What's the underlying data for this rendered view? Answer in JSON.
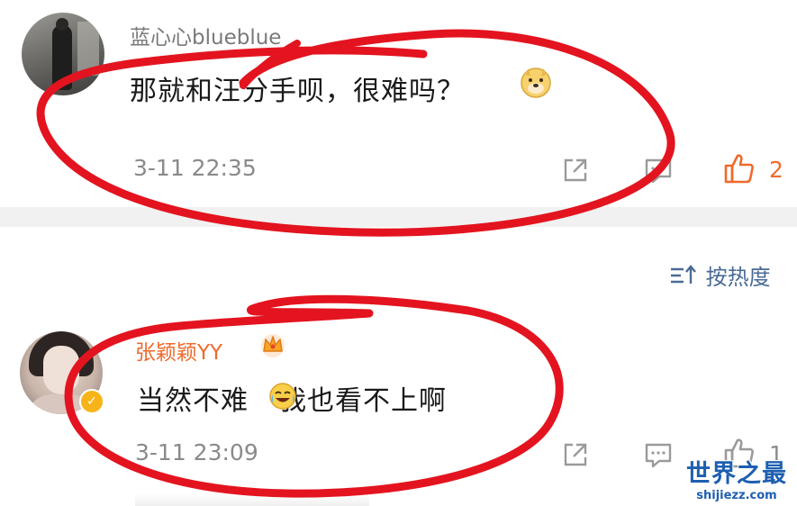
{
  "colors": {
    "accent_orange": "#ef6a2c",
    "link_blue": "#4a6b96",
    "annotation_red": "#e3141f",
    "meta_gray": "#8a8a8a"
  },
  "comments": [
    {
      "username": "蓝心心blueblue",
      "text": "那就和汪分手呗，很难吗？",
      "emoji": "doge-emoji",
      "timestamp": "3-11 22:35",
      "like_count": "2"
    },
    {
      "username": "张颖颖YY",
      "badge_icon": "crown-icon",
      "text_before": "当然不难",
      "emoji": "laugh-cry-emoji",
      "text_after": "我也看不上啊",
      "timestamp": "3-11 23:09",
      "like_count": "1"
    }
  ],
  "sort": {
    "label": "按热度",
    "icon": "sort-icon"
  },
  "watermark": {
    "title": "世界之最",
    "url": "shijiezz.com"
  }
}
